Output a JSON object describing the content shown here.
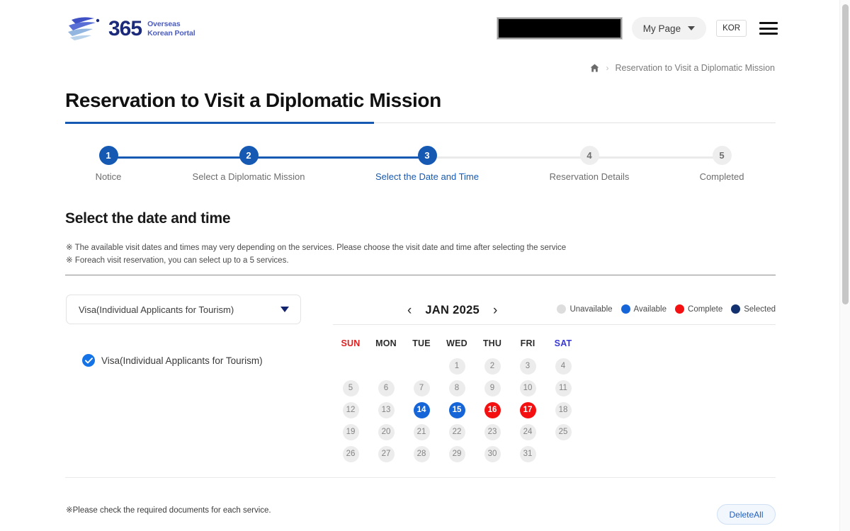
{
  "header": {
    "logo": {
      "brand_number": "365",
      "line1": "Overseas",
      "line2": "Korean Portal"
    },
    "redacted_field": "",
    "my_page_label": "My Page",
    "lang_label": "KOR",
    "menu_icon": "hamburger-menu-icon"
  },
  "breadcrumb": {
    "home_icon": "home-icon",
    "separator": "›",
    "current": "Reservation to Visit a Diplomatic Mission"
  },
  "page_title": "Reservation to Visit a Diplomatic Mission",
  "stepper": {
    "steps": [
      {
        "num": "1",
        "label": "Notice",
        "state": "done"
      },
      {
        "num": "2",
        "label": "Select a Diplomatic Mission",
        "state": "done"
      },
      {
        "num": "3",
        "label": "Select the Date and Time",
        "state": "current"
      },
      {
        "num": "4",
        "label": "Reservation Details",
        "state": "todo"
      },
      {
        "num": "5",
        "label": "Completed",
        "state": "todo"
      }
    ]
  },
  "section": {
    "title": "Select the date and time",
    "note1": "※ The available visit dates and times may very depending on the services. Please choose the visit date and time after selecting the service",
    "note2": "※ Foreach visit reservation, you can select up to a 5 services."
  },
  "service_select": {
    "selected_value": "Visa(Individual Applicants for Tourism)",
    "caret_icon": "chevron-down-icon"
  },
  "selected_services": [
    {
      "label": "Visa(Individual Applicants for Tourism)",
      "checked": true,
      "icon": "check-circle-icon"
    }
  ],
  "calendar": {
    "prev_icon": "chevron-left-icon",
    "next_icon": "chevron-right-icon",
    "month_label": "JAN 2025",
    "legend": [
      {
        "label": "Unavailable",
        "color": "#dddddd"
      },
      {
        "label": "Available",
        "color": "#1565d8"
      },
      {
        "label": "Complete",
        "color": "#f41010"
      },
      {
        "label": "Selected",
        "color": "#13316e"
      }
    ],
    "weekdays": [
      {
        "label": "SUN",
        "kind": "sun"
      },
      {
        "label": "MON",
        "kind": "wd"
      },
      {
        "label": "TUE",
        "kind": "wd"
      },
      {
        "label": "WED",
        "kind": "wd"
      },
      {
        "label": "THU",
        "kind": "wd"
      },
      {
        "label": "FRI",
        "kind": "wd"
      },
      {
        "label": "SAT",
        "kind": "sat"
      }
    ],
    "days": [
      {
        "label": "",
        "state": "empty"
      },
      {
        "label": "",
        "state": "empty"
      },
      {
        "label": "",
        "state": "empty"
      },
      {
        "label": "1",
        "state": "unavailable"
      },
      {
        "label": "2",
        "state": "unavailable"
      },
      {
        "label": "3",
        "state": "unavailable"
      },
      {
        "label": "4",
        "state": "unavailable"
      },
      {
        "label": "5",
        "state": "unavailable"
      },
      {
        "label": "6",
        "state": "unavailable"
      },
      {
        "label": "7",
        "state": "unavailable"
      },
      {
        "label": "8",
        "state": "unavailable"
      },
      {
        "label": "9",
        "state": "unavailable"
      },
      {
        "label": "10",
        "state": "unavailable"
      },
      {
        "label": "11",
        "state": "unavailable"
      },
      {
        "label": "12",
        "state": "unavailable"
      },
      {
        "label": "13",
        "state": "unavailable"
      },
      {
        "label": "14",
        "state": "available"
      },
      {
        "label": "15",
        "state": "available"
      },
      {
        "label": "16",
        "state": "complete"
      },
      {
        "label": "17",
        "state": "complete"
      },
      {
        "label": "18",
        "state": "unavailable"
      },
      {
        "label": "19",
        "state": "unavailable"
      },
      {
        "label": "20",
        "state": "unavailable"
      },
      {
        "label": "21",
        "state": "unavailable"
      },
      {
        "label": "22",
        "state": "unavailable"
      },
      {
        "label": "23",
        "state": "unavailable"
      },
      {
        "label": "24",
        "state": "unavailable"
      },
      {
        "label": "25",
        "state": "unavailable"
      },
      {
        "label": "26",
        "state": "unavailable"
      },
      {
        "label": "27",
        "state": "unavailable"
      },
      {
        "label": "28",
        "state": "unavailable"
      },
      {
        "label": "29",
        "state": "unavailable"
      },
      {
        "label": "30",
        "state": "unavailable"
      },
      {
        "label": "31",
        "state": "unavailable"
      },
      {
        "label": "",
        "state": "empty"
      }
    ]
  },
  "footer": {
    "note": "※Please check the required documents for each service.",
    "delete_all_label": "DeleteAll"
  },
  "colors": {
    "brand_blue": "#1559b3",
    "available": "#1565d8",
    "complete": "#f41010",
    "selected": "#13316e",
    "unavailable": "#ececec"
  }
}
